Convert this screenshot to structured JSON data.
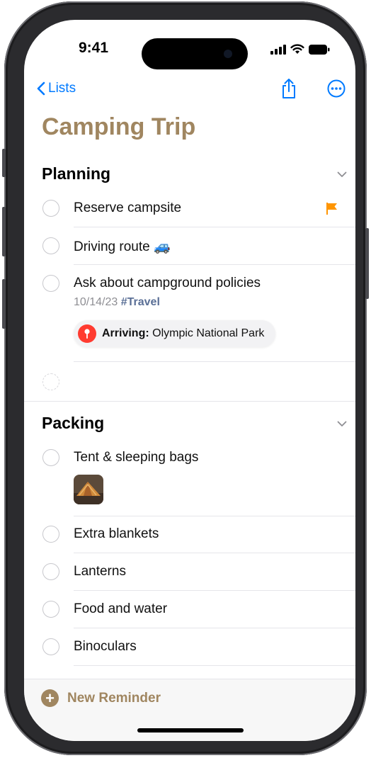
{
  "status": {
    "time": "9:41"
  },
  "nav": {
    "back_label": "Lists"
  },
  "list": {
    "title": "Camping Trip"
  },
  "sections": [
    {
      "title": "Planning",
      "items": [
        {
          "label": "Reserve campsite",
          "flagged": true
        },
        {
          "label": "Driving route",
          "emoji": "🚙"
        },
        {
          "label": "Ask about campground policies",
          "date": "10/14/23",
          "tag": "#Travel",
          "location_prefix": "Arriving:",
          "location": "Olympic National Park"
        },
        {
          "label": ""
        }
      ]
    },
    {
      "title": "Packing",
      "items": [
        {
          "label": "Tent & sleeping bags",
          "has_image": true
        },
        {
          "label": "Extra blankets"
        },
        {
          "label": "Lanterns"
        },
        {
          "label": "Food and water"
        },
        {
          "label": "Binoculars"
        }
      ]
    }
  ],
  "bottom": {
    "new_reminder_label": "New Reminder"
  },
  "colors": {
    "accent": "#a08660",
    "flag": "#ff9500",
    "link": "#007aff",
    "location_pin": "#ff3b30"
  }
}
